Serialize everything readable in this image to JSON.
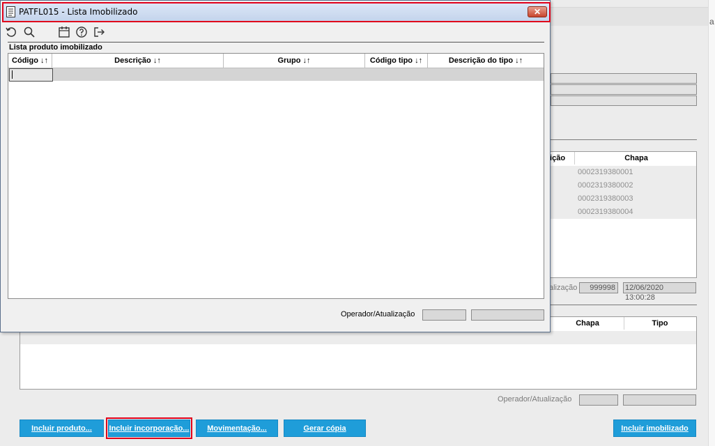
{
  "dialog": {
    "title": "PATFL015 - Lista Imobilizado",
    "close_icon": "close-x-icon",
    "toolbar": [
      {
        "icon": "refresh-icon"
      },
      {
        "icon": "search-icon"
      },
      {
        "icon": "calendar-icon"
      },
      {
        "icon": "help-icon"
      },
      {
        "icon": "exit-icon"
      }
    ],
    "list_title": "Lista produto imobilizado",
    "columns": [
      "Código ↓↑",
      "Descrição ↓↑",
      "Grupo ↓↑",
      "Código tipo ↓↑",
      "Descrição do tipo ↓↑"
    ],
    "operator_label": "Operador/Atualização"
  },
  "background": {
    "right_edge_char": "a",
    "grid1": {
      "header_partial": "sição",
      "header_chapa": "Chapa",
      "chapas": [
        "0002319380001",
        "0002319380002",
        "0002319380003",
        "0002319380004"
      ],
      "operator_label_partial": "alização",
      "operator_value": "999998",
      "timestamp": "12/06/2020 13:00:28"
    },
    "grid2": {
      "header_chapa": "Chapa",
      "header_tipo": "Tipo"
    },
    "operator_label": "Operador/Atualização"
  },
  "buttons": {
    "incluir_produto": {
      "pre": "Incluir ",
      "u": "p",
      "post": "roduto..."
    },
    "incluir_incorporacao": {
      "pre": "Incluir ",
      "u": "i",
      "post": "ncorporação..."
    },
    "movimentacao": {
      "pre": "",
      "u": "M",
      "post": "ovimentação..."
    },
    "gerar_copia": {
      "pre": "",
      "u": "G",
      "post": "erar cópia"
    },
    "incluir_imobilizado": {
      "pre": "Incluir ",
      "u": "i",
      "post": "mobilizado"
    }
  },
  "colors": {
    "accent_button": "#1f9dd9",
    "highlight_red": "#e0001a",
    "titlebar": "#c4d4ec"
  }
}
